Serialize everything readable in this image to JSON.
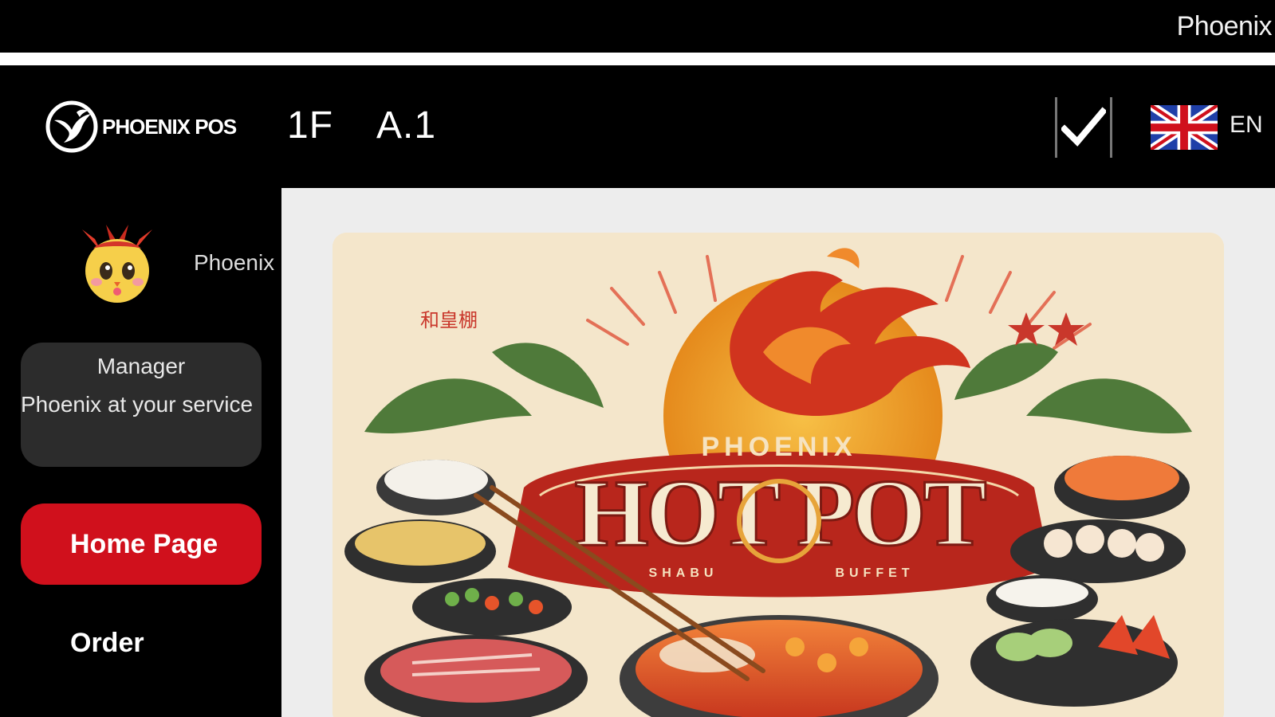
{
  "top_bar": {
    "title": "Phoenix"
  },
  "header": {
    "logo_text": "PHOENIX POS",
    "table_number": "1F  A.1",
    "language": "EN",
    "icons": [
      "phoenix-logo-icon",
      "checkmark-icon",
      "uk-flag-icon"
    ]
  },
  "sidebar": {
    "user_name": "Phoenix",
    "role": {
      "title": "Manager",
      "greeting": "Phoenix at your service"
    },
    "nav": {
      "home_label": "Home Page",
      "order_label": "Order"
    }
  },
  "poster": {
    "brand": "PHOENIX",
    "title": "HOT POT",
    "subtitle_left": "SHABU",
    "subtitle_right": "BUFFET"
  },
  "colors": {
    "accent_red": "#d0101c",
    "card_gray": "#2c2c2c",
    "content_bg": "#ededed"
  }
}
